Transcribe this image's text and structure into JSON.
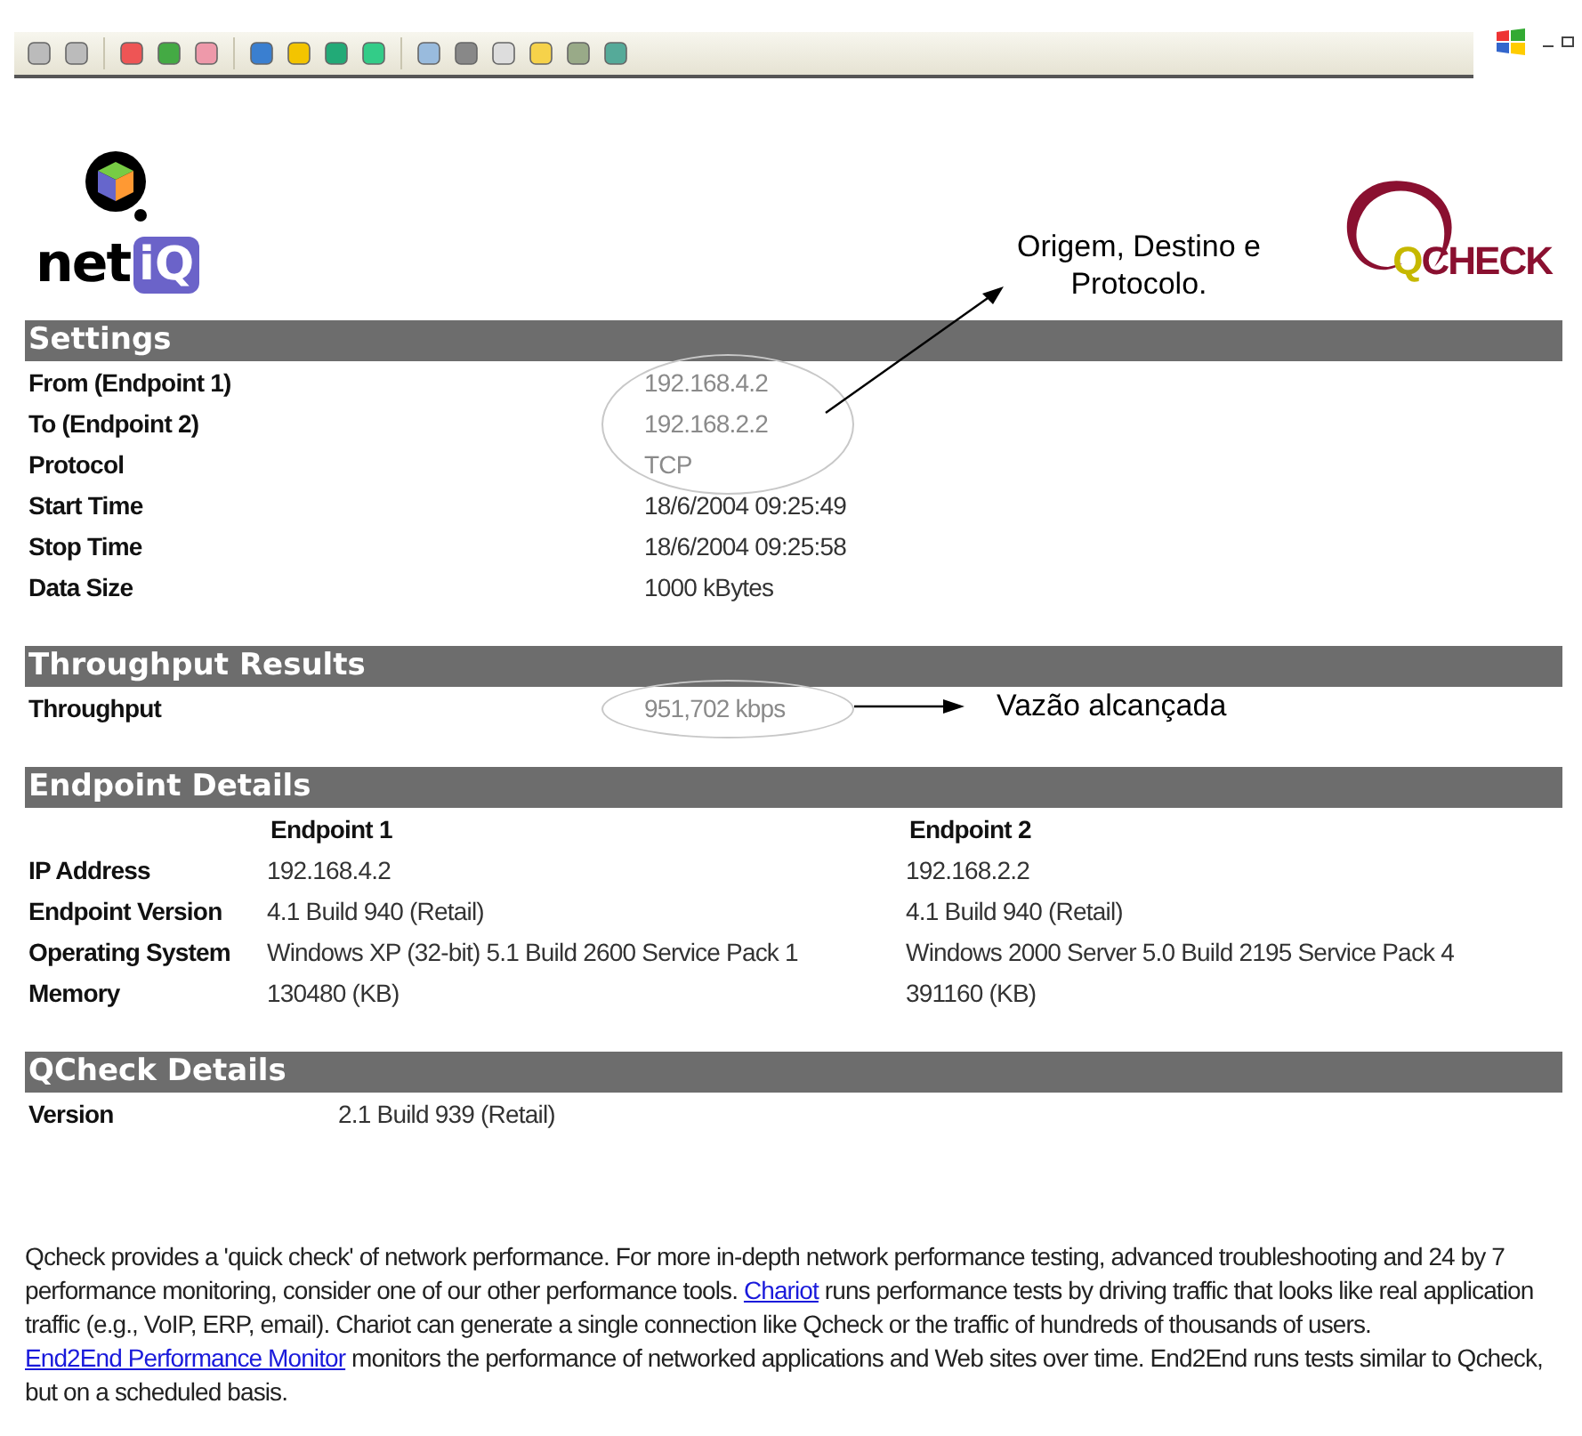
{
  "logos": {
    "left": {
      "word": "net",
      "badge": "iQ"
    },
    "right": {
      "initial": "Q",
      "word": "CHECK"
    }
  },
  "sections": [
    {
      "kind": "pairs",
      "title": "Settings",
      "rows": [
        {
          "label": "From (Endpoint 1)",
          "value": "192.168.4.2",
          "highlighted": true
        },
        {
          "label": "To (Endpoint 2)",
          "value": "192.168.2.2",
          "highlighted": true
        },
        {
          "label": "Protocol",
          "value": "TCP",
          "highlighted": true
        },
        {
          "label": "Start Time",
          "value": "18/6/2004 09:25:49",
          "highlighted": false
        },
        {
          "label": "Stop Time",
          "value": "18/6/2004 09:25:58",
          "highlighted": false
        },
        {
          "label": "Data Size",
          "value": "1000 kBytes",
          "highlighted": false
        }
      ],
      "note": "Origem, Destino e Protocolo."
    },
    {
      "kind": "pairs",
      "title": "Throughput Results",
      "rows": [
        {
          "label": "Throughput",
          "value": "951,702 kbps",
          "highlighted": true
        }
      ],
      "note": "Vazão alcançada"
    },
    {
      "kind": "table",
      "title": "Endpoint Details",
      "columns": [
        "Endpoint 1",
        "Endpoint 2"
      ],
      "rows": [
        {
          "label": "IP Address",
          "cells": [
            "192.168.4.2",
            "192.168.2.2"
          ]
        },
        {
          "label": "Endpoint Version",
          "cells": [
            "4.1 Build 940 (Retail)",
            "4.1 Build 940 (Retail)"
          ]
        },
        {
          "label": "Operating System",
          "cells": [
            "Windows XP (32-bit) 5.1 Build 2600 Service Pack 1",
            "Windows 2000 Server 5.0 Build 2195 Service Pack 4"
          ]
        },
        {
          "label": "Memory",
          "cells": [
            "130480 (KB)",
            "391160 (KB)"
          ]
        }
      ]
    },
    {
      "kind": "short",
      "title": "QCheck Details",
      "rows": [
        {
          "label": "Version",
          "value": "2.1 Build 939 (Retail)",
          "highlighted": false
        }
      ]
    }
  ],
  "footer": [
    {
      "kind": "text",
      "text": "Qcheck provides a 'quick check' of network performance. For more in-depth network performance testing, advanced troubleshooting and 24 by 7 performance monitoring, consider one of our other performance tools. "
    },
    {
      "kind": "link",
      "text": "Chariot"
    },
    {
      "kind": "text",
      "text": " runs performance tests by driving traffic that looks like real application traffic (e.g., VoIP, ERP, email). Chariot can generate a single connection like Qcheck or the traffic of hundreds of thousands of users. "
    },
    {
      "kind": "link",
      "text": "End2End Performance Monitor"
    },
    {
      "kind": "text",
      "text": " monitors the performance of networked applications and Web sites over time. End2End runs tests similar to Qcheck, but on a scheduled basis."
    }
  ]
}
